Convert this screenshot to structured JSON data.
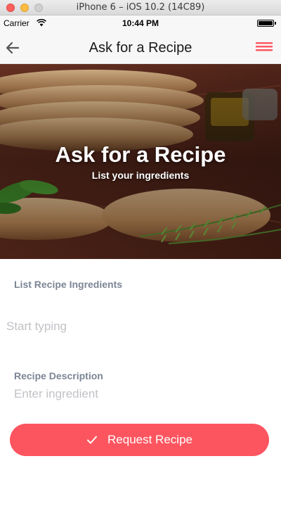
{
  "simulator": {
    "window_title": "iPhone 6 – iOS 10.2 (14C89)"
  },
  "status_bar": {
    "carrier": "Carrier",
    "time": "10:44 PM",
    "battery_level": 1.0
  },
  "nav": {
    "title": "Ask for a Recipe",
    "back_icon": "arrow-left-icon",
    "menu_icon": "hamburger-menu-icon",
    "accent_color": "#fd555f"
  },
  "hero": {
    "title": "Ask for a Recipe",
    "subtitle": "List your ingredients"
  },
  "form": {
    "ingredients_label": "List Recipe Ingredients",
    "ingredients_placeholder": "Start typing",
    "description_label": "Recipe Description",
    "description_placeholder": "Enter ingredient"
  },
  "submit": {
    "label": "Request Recipe",
    "icon": "check-icon",
    "color": "#fd555f"
  }
}
